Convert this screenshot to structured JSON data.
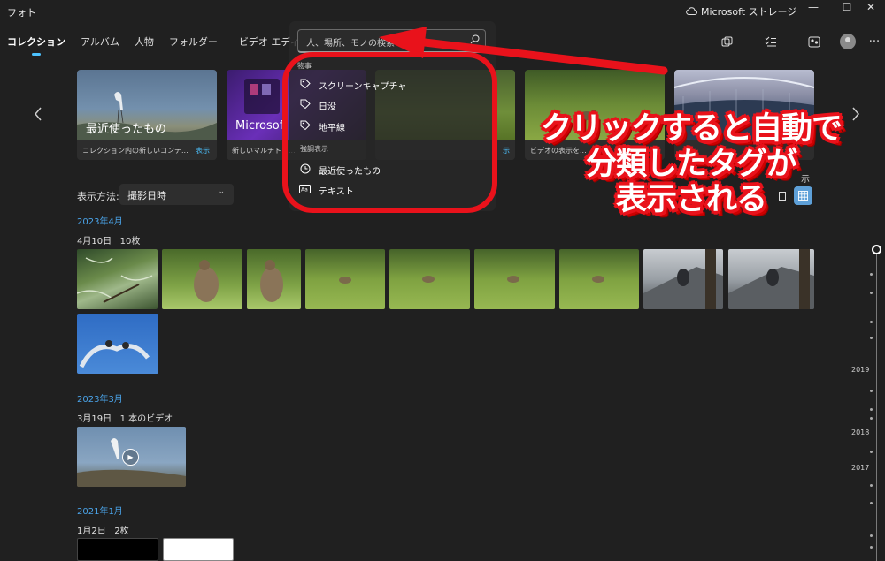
{
  "window": {
    "title": "フォト",
    "storage_label": "Microsoft ストレージ",
    "minimize": "—",
    "maximize": "☐",
    "close": "✕"
  },
  "nav": {
    "tabs": [
      "コレクション",
      "アルバム",
      "人物",
      "フォルダー",
      "ビデオ エディター"
    ]
  },
  "toolbar": {
    "icons": [
      "import-icon",
      "select-icon",
      "people-icon",
      "account-icon",
      "more-icon"
    ],
    "more": "···"
  },
  "carousel": {
    "cards": [
      {
        "title": "最近使ったもの",
        "caption": "コレクション内の新しいコンテ...",
        "link": "表示"
      },
      {
        "title": "Microsoft",
        "caption": "新しいマルチトラ...",
        "link": ""
      },
      {
        "title": "",
        "caption": "",
        "link": "示"
      },
      {
        "title": "",
        "caption": "ビデオの表示を...",
        "link": ""
      },
      {
        "title": "",
        "caption": "",
        "link": ""
      }
    ]
  },
  "sort": {
    "label": "表示方法:",
    "value": "撮影日時",
    "chevron": "⌄",
    "partial_label": "示"
  },
  "groups": [
    {
      "month": "2023年4月",
      "day": "4月10日",
      "count": "10枚"
    },
    {
      "month": "2023年3月",
      "day": "3月19日",
      "count": "1 本のビデオ"
    },
    {
      "month": "2021年1月",
      "day": "1月2日",
      "count": "2枚"
    }
  ],
  "timeline": {
    "years": [
      "2019",
      "2018",
      "2017"
    ]
  },
  "search": {
    "placeholder": "人、場所、モノの検索",
    "section_things_partial": "物事",
    "tags": [
      "スクリーンキャプチャ",
      "日没",
      "地平線"
    ],
    "section_highlight": "強調表示",
    "highlights": [
      "最近使ったもの",
      "テキスト"
    ]
  },
  "annotation": {
    "lines": [
      "クリックすると自動で",
      "分類したタグが",
      "表示される"
    ],
    "color": "#e9121b"
  }
}
